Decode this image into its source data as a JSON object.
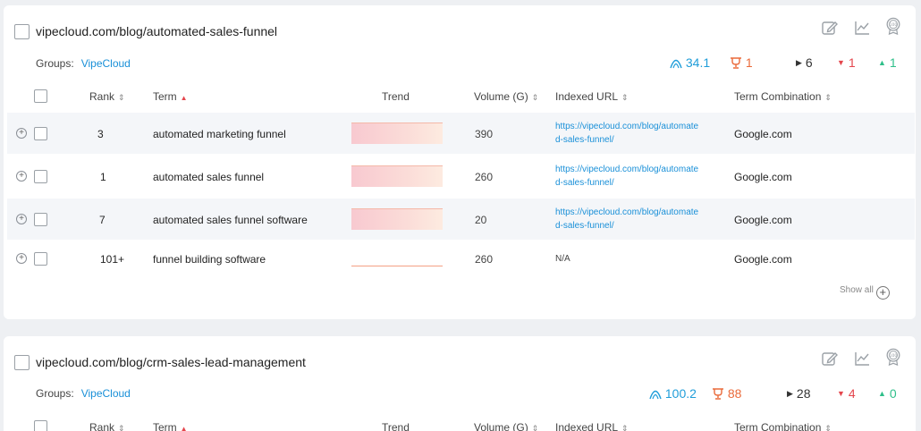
{
  "cards": [
    {
      "url": "vipecloud.com/blog/automated-sales-funnel",
      "groups_label": "Groups:",
      "group": "VipeCloud",
      "stats": {
        "visibility": "34.1",
        "trophy": "1",
        "neutral": "6",
        "down": "1",
        "up": "1"
      },
      "columns": {
        "rank": "Rank",
        "term": "Term",
        "trend": "Trend",
        "volume": "Volume (G)",
        "indexed_url": "Indexed URL",
        "term_combination": "Term Combination"
      },
      "rows": [
        {
          "rank": "3",
          "term": "automated marketing funnel",
          "volume": "390",
          "url_line1": "https://vipecloud.com/blog/automate",
          "url_line2": "d-sales-funnel/",
          "combination": "Google.com"
        },
        {
          "rank": "1",
          "term": "automated sales funnel",
          "volume": "260",
          "url_line1": "https://vipecloud.com/blog/automate",
          "url_line2": "d-sales-funnel/",
          "combination": "Google.com"
        },
        {
          "rank": "7",
          "term": "automated sales funnel software",
          "volume": "20",
          "url_line1": "https://vipecloud.com/blog/automate",
          "url_line2": "d-sales-funnel/",
          "combination": "Google.com"
        },
        {
          "rank": "101+",
          "term": "funnel building software",
          "volume": "260",
          "url_na": "N/A",
          "combination": "Google.com"
        }
      ],
      "show_all": "Show all"
    },
    {
      "url": "vipecloud.com/blog/crm-sales-lead-management",
      "groups_label": "Groups:",
      "group": "VipeCloud",
      "stats": {
        "visibility": "100.2",
        "trophy": "88",
        "neutral": "28",
        "down": "4",
        "up": "0"
      },
      "columns": {
        "rank": "Rank",
        "term": "Term",
        "trend": "Trend",
        "volume": "Volume (G)",
        "indexed_url": "Indexed URL",
        "term_combination": "Term Combination"
      }
    }
  ],
  "icons": {
    "edit": "edit-icon",
    "chart": "line-chart-icon",
    "badge": "award-badge-icon",
    "visibility": "visibility-arc-icon",
    "trophy": "trophy-icon"
  },
  "colors": {
    "link": "#1a90d8",
    "visibility": "#1f9dd9",
    "trophy": "#ea6a3a",
    "down": "#e4464d",
    "up": "#2fbf8a"
  }
}
